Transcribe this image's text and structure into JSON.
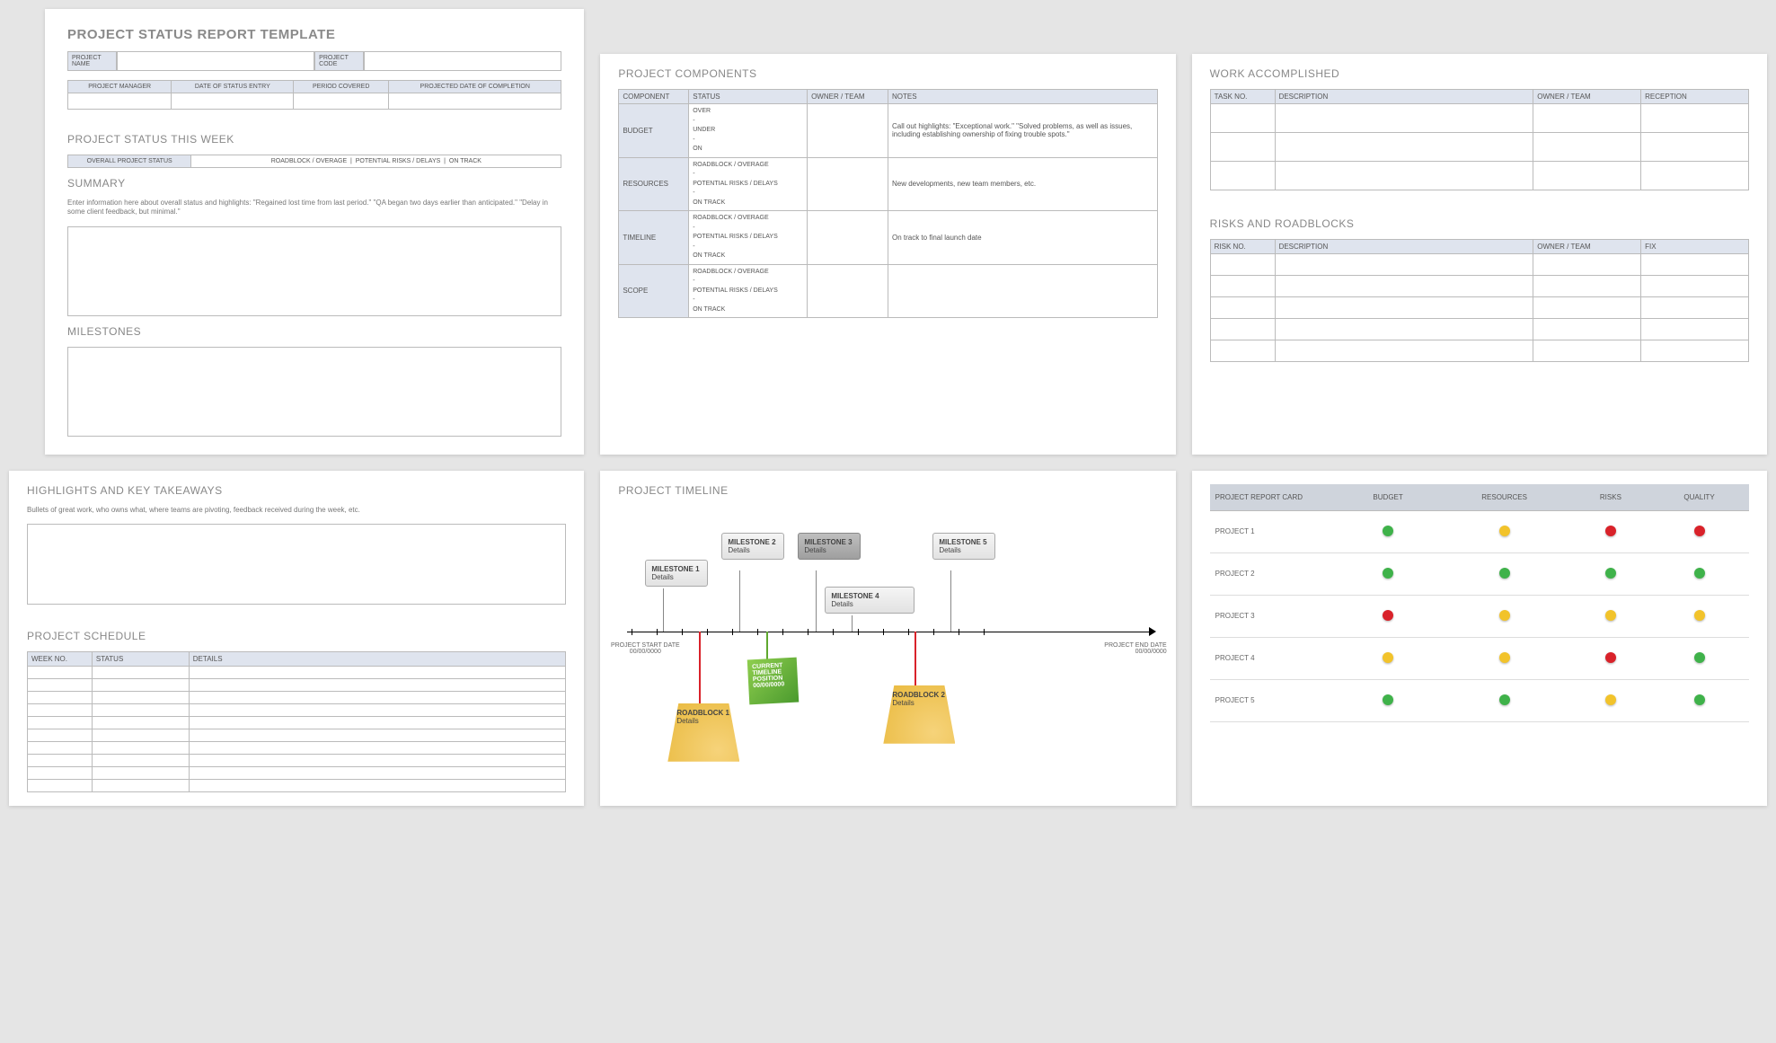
{
  "page1": {
    "title": "PROJECT STATUS REPORT TEMPLATE",
    "fields": {
      "project_name": "PROJECT NAME",
      "project_code": "PROJECT CODE",
      "cols": [
        "PROJECT MANAGER",
        "DATE OF STATUS ENTRY",
        "PERIOD COVERED",
        "PROJECTED DATE OF COMPLETION"
      ]
    },
    "status_week": "PROJECT STATUS THIS WEEK",
    "legend": [
      "OVERALL PROJECT STATUS",
      "ROADBLOCK / OVERAGE",
      "POTENTIAL RISKS / DELAYS",
      "ON TRACK"
    ],
    "summary_label": "SUMMARY",
    "summary_hint": "Enter information here about overall status and highlights: \"Regained lost time from last period.\" \"QA began two days earlier than anticipated.\" \"Delay in some client feedback, but minimal.\"",
    "milestones_label": "MILESTONES"
  },
  "page2": {
    "title": "PROJECT COMPONENTS",
    "headers": [
      "COMPONENT",
      "STATUS",
      "OWNER / TEAM",
      "NOTES"
    ],
    "rows": [
      {
        "comp": "BUDGET",
        "status": "OVER\n-\nUNDER\n-\nON",
        "notes": "Call out highlights: \"Exceptional work.\" \"Solved problems, as well as issues, including establishing ownership of fixing trouble spots.\""
      },
      {
        "comp": "RESOURCES",
        "status": "ROADBLOCK / OVERAGE\n-\nPOTENTIAL RISKS / DELAYS\n-\nON TRACK",
        "notes": "New developments, new team members, etc."
      },
      {
        "comp": "TIMELINE",
        "status": "ROADBLOCK / OVERAGE\n-\nPOTENTIAL RISKS / DELAYS\n-\nON TRACK",
        "notes": "On track to final launch date"
      },
      {
        "comp": "SCOPE",
        "status": "ROADBLOCK / OVERAGE\n-\nPOTENTIAL RISKS / DELAYS\n-\nON TRACK",
        "notes": ""
      }
    ]
  },
  "page3": {
    "work_title": "WORK ACCOMPLISHED",
    "work_headers": [
      "TASK NO.",
      "DESCRIPTION",
      "OWNER / TEAM",
      "RECEPTION"
    ],
    "risks_title": "RISKS AND ROADBLOCKS",
    "risks_headers": [
      "RISK NO.",
      "DESCRIPTION",
      "OWNER / TEAM",
      "FIX"
    ]
  },
  "page4": {
    "hl_title": "HIGHLIGHTS AND KEY TAKEAWAYS",
    "hl_hint": "Bullets of great work, who owns what, where teams are pivoting, feedback received during the week, etc.",
    "sched_title": "PROJECT SCHEDULE",
    "sched_headers": [
      "WEEK NO.",
      "STATUS",
      "DETAILS"
    ]
  },
  "page5": {
    "title": "PROJECT TIMELINE",
    "start_label": "PROJECT START DATE",
    "start_date": "00/00/0000",
    "end_label": "PROJECT END DATE",
    "end_date": "00/00/0000",
    "milestones": [
      {
        "n": "MILESTONE 1",
        "d": "Details"
      },
      {
        "n": "MILESTONE 2",
        "d": "Details"
      },
      {
        "n": "MILESTONE 3",
        "d": "Details"
      },
      {
        "n": "MILESTONE 4",
        "d": "Details"
      },
      {
        "n": "MILESTONE 5",
        "d": "Details"
      }
    ],
    "current": "CURRENT TIMELINE POSITION 00/00/0000",
    "roadblocks": [
      {
        "n": "ROADBLOCK 1",
        "d": "Details"
      },
      {
        "n": "ROADBLOCK 2",
        "d": "Details"
      }
    ]
  },
  "page6": {
    "headers": [
      "PROJECT REPORT CARD",
      "BUDGET",
      "RESOURCES",
      "RISKS",
      "QUALITY"
    ],
    "rows": [
      {
        "name": "PROJECT 1",
        "dots": [
          "g",
          "y",
          "r",
          "r"
        ]
      },
      {
        "name": "PROJECT 2",
        "dots": [
          "g",
          "g",
          "g",
          "g"
        ]
      },
      {
        "name": "PROJECT 3",
        "dots": [
          "r",
          "y",
          "y",
          "y"
        ]
      },
      {
        "name": "PROJECT 4",
        "dots": [
          "y",
          "y",
          "r",
          "g"
        ]
      },
      {
        "name": "PROJECT 5",
        "dots": [
          "g",
          "g",
          "y",
          "g"
        ]
      }
    ]
  }
}
